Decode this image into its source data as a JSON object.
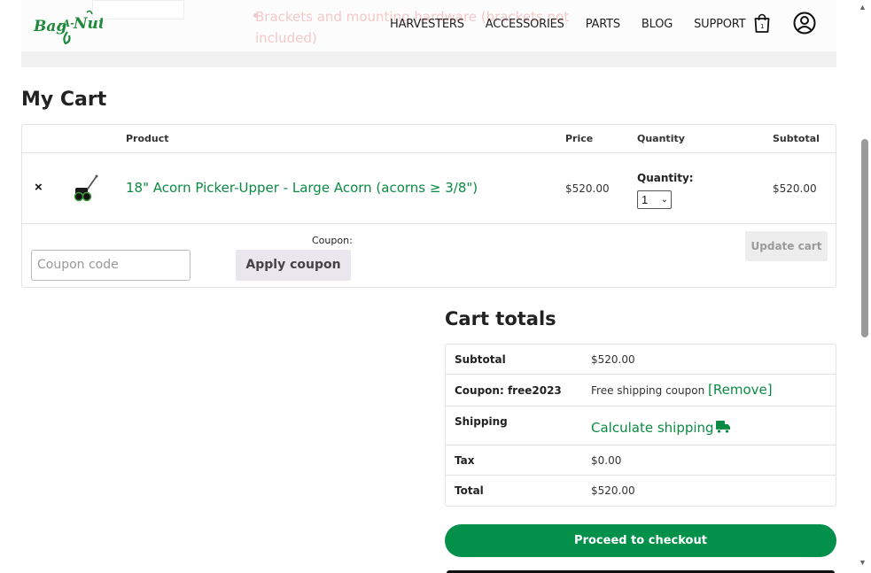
{
  "header": {
    "logo_text": "Bag-A-Nut",
    "nav": [
      "HARVESTERS",
      "ACCESSORIES",
      "PARTS",
      "BLOG",
      "SUPPORT"
    ],
    "icons": {
      "cart": "shopping-bag-icon",
      "account": "user-circle-icon"
    }
  },
  "behind": {
    "line1": "Brackets and mounting hardware (brackets not",
    "line2": "included)"
  },
  "page": {
    "title": "My Cart"
  },
  "cart": {
    "headers": {
      "product": "Product",
      "price": "Price",
      "quantity": "Quantity",
      "subtotal": "Subtotal"
    },
    "item": {
      "remove": "×",
      "name": "18\" Acorn Picker-Upper - Large Acorn (acorns ≥ 3/8\")",
      "price": "$520.00",
      "quantity_label": "Quantity:",
      "quantity": "1",
      "subtotal": "$520.00"
    },
    "coupon": {
      "label": "Coupon:",
      "placeholder": "Coupon code",
      "apply": "Apply coupon"
    },
    "update": "Update cart"
  },
  "totals": {
    "title": "Cart totals",
    "subtotal_label": "Subtotal",
    "subtotal_value": "$520.00",
    "coupon_label": "Coupon: free2023",
    "coupon_value": "Free shipping coupon",
    "coupon_remove": "[Remove]",
    "shipping_label": "Shipping",
    "shipping_link": "Calculate shipping",
    "tax_label": "Tax",
    "tax_value": "$0.00",
    "total_label": "Total",
    "total_value": "$520.00",
    "checkout": "Proceed to checkout"
  },
  "colors": {
    "accent": "#03904a",
    "link": "#0b8a43"
  }
}
